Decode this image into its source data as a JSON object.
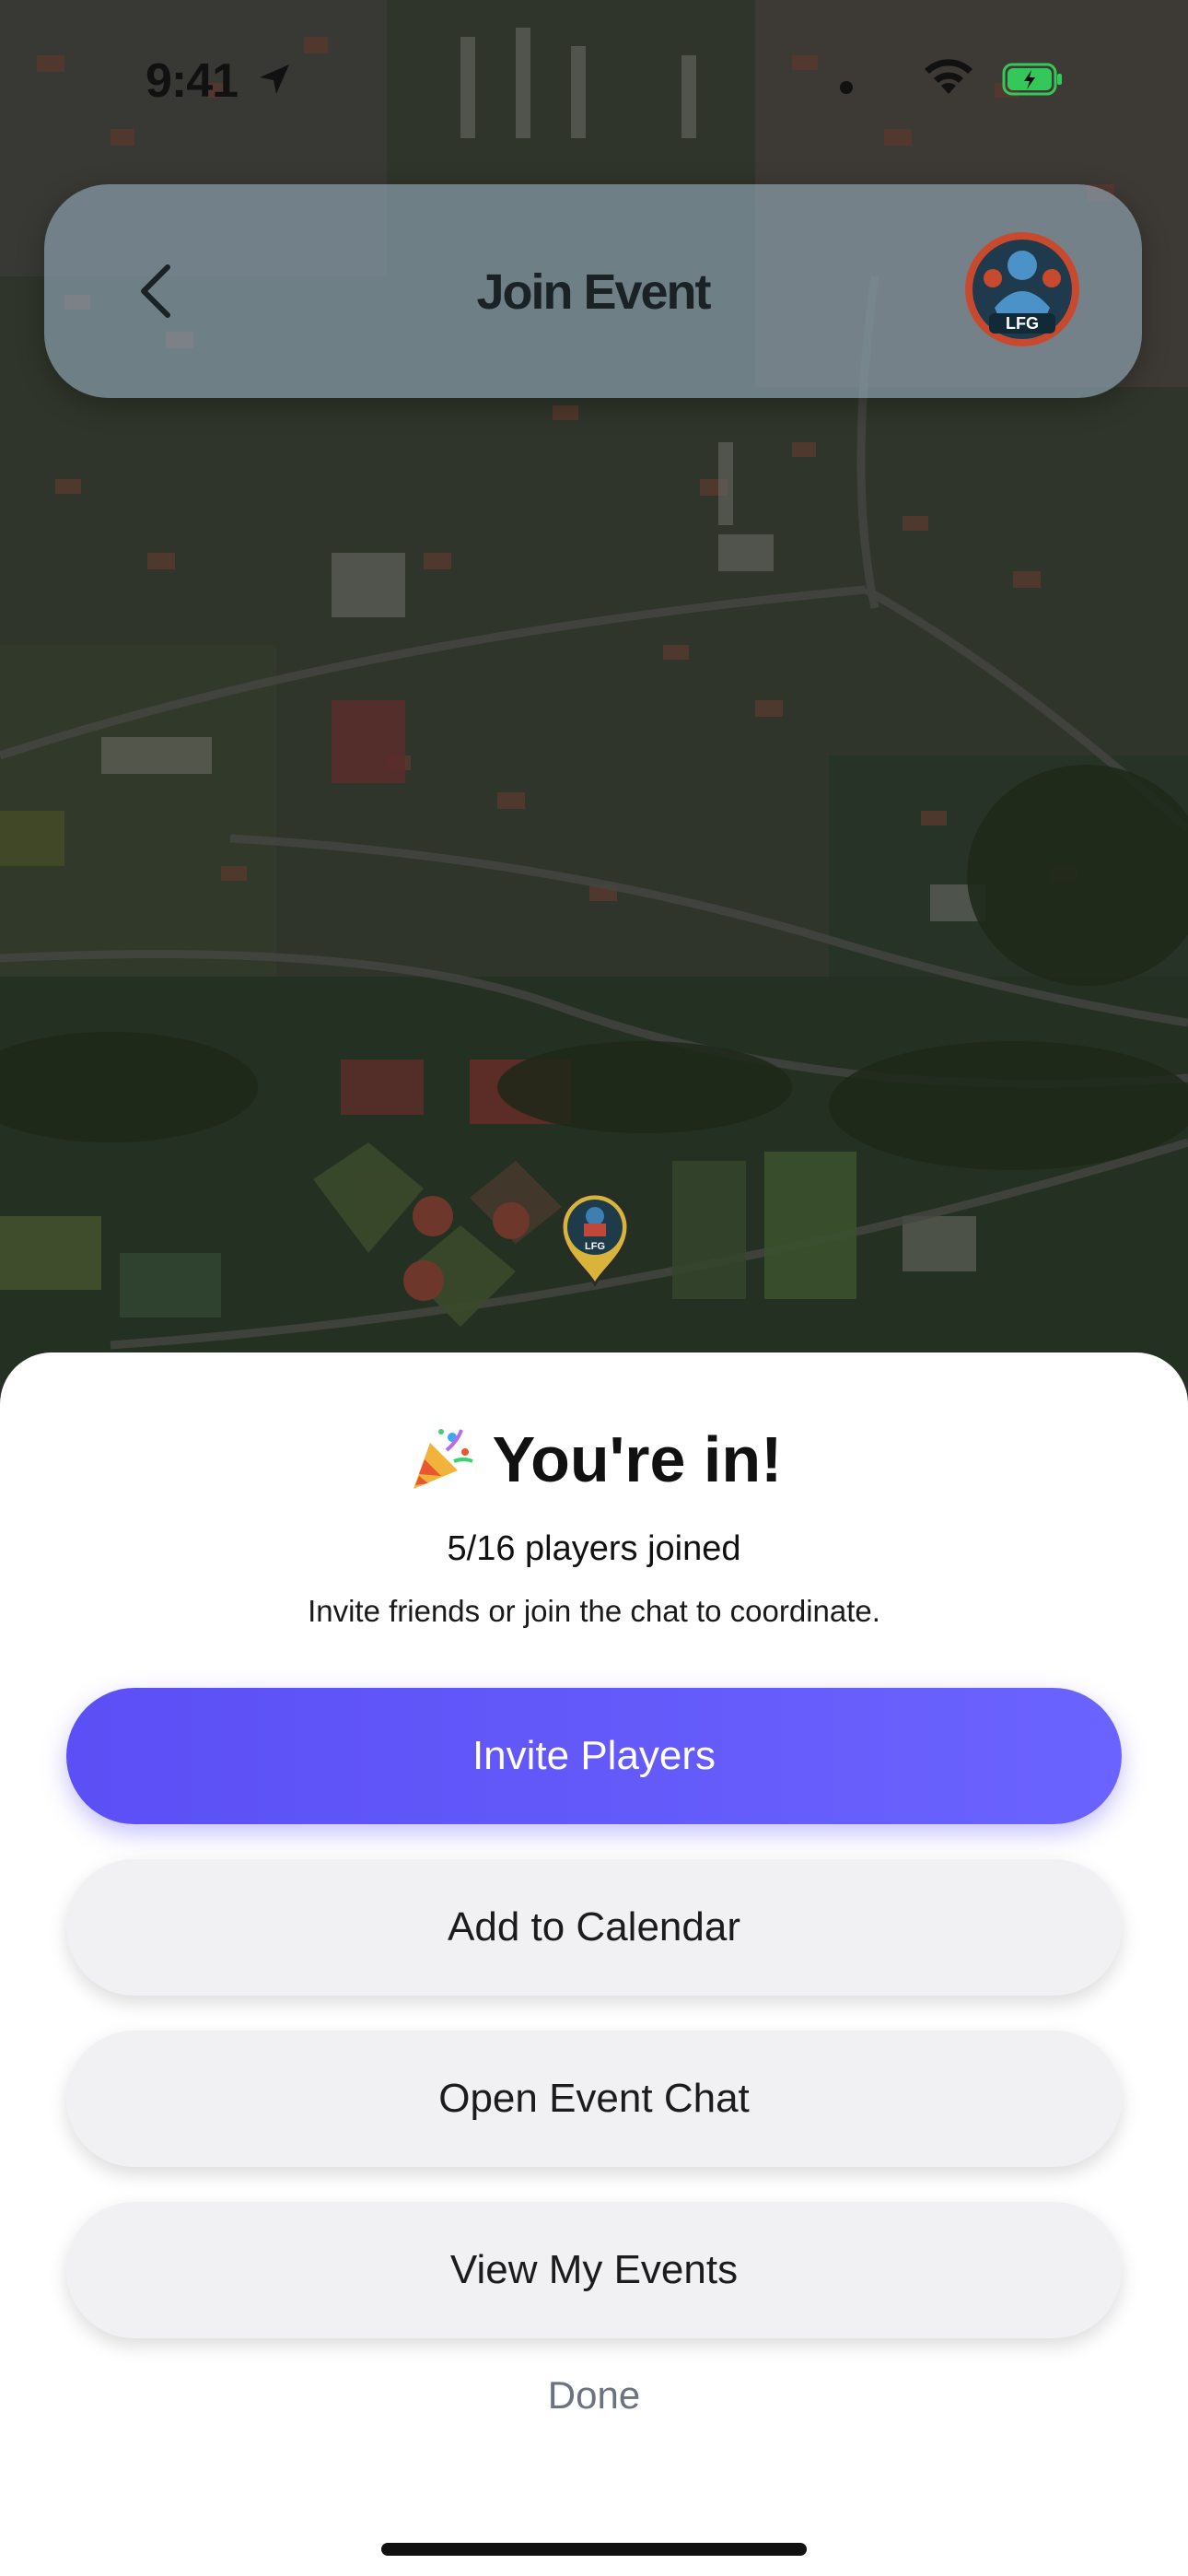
{
  "status_bar": {
    "time": "9:41",
    "icons": [
      "location-arrow-icon",
      "wifi-icon",
      "battery-charging-icon"
    ],
    "battery_color": "#34c759"
  },
  "header": {
    "title": "Join Event",
    "back_icon": "chevron-left-icon",
    "avatar_logo_text": "LFG"
  },
  "map": {
    "pin_logo_text": "LFG"
  },
  "sheet": {
    "title_emoji": "party-popper-icon",
    "title": "You're in!",
    "players_joined": "5/16 players joined",
    "subtitle": "Invite friends or join the chat to coordinate.",
    "buttons": {
      "invite": "Invite Players",
      "calendar": "Add to Calendar",
      "chat": "Open Event Chat",
      "events": "View My Events"
    },
    "done": "Done"
  },
  "colors": {
    "primary": "#5b4ff5",
    "secondary_bg": "#f1f1f4",
    "done_text": "#6b7280"
  }
}
